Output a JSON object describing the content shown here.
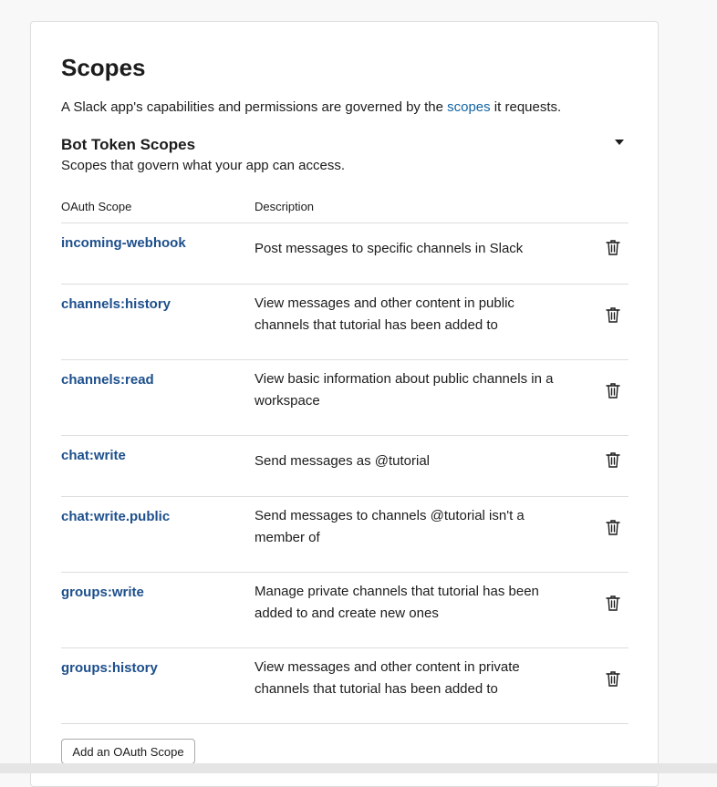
{
  "header": {
    "title": "Scopes",
    "intro_before": "A Slack app's capabilities and permissions are governed by the ",
    "intro_link": "scopes",
    "intro_after": " it requests."
  },
  "bot_scopes": {
    "title": "Bot Token Scopes",
    "subtitle": "Scopes that govern what your app can access.",
    "col_scope": "OAuth Scope",
    "col_description": "Description",
    "rows": [
      {
        "scope": "incoming-webhook",
        "description": "Post messages to specific channels in Slack"
      },
      {
        "scope": "channels:history",
        "description": "View messages and other content in public channels that tutorial has been added to"
      },
      {
        "scope": "channels:read",
        "description": "View basic information about public channels in a workspace"
      },
      {
        "scope": "chat:write",
        "description": "Send messages as @tutorial"
      },
      {
        "scope": "chat:write.public",
        "description": "Send messages to channels @tutorial isn't a member of"
      },
      {
        "scope": "groups:write",
        "description": "Manage private channels that tutorial has been added to and create new ones"
      },
      {
        "scope": "groups:history",
        "description": "View messages and other content in private channels that tutorial has been added to"
      }
    ],
    "add_button": "Add an OAuth Scope"
  },
  "colors": {
    "link": "#1264a3",
    "scope_link": "#1d4f8c",
    "text": "#1d1c1d",
    "divider": "#dddddd"
  },
  "icons": {
    "collapse": "caret-down-icon",
    "remove": "trash-icon"
  }
}
